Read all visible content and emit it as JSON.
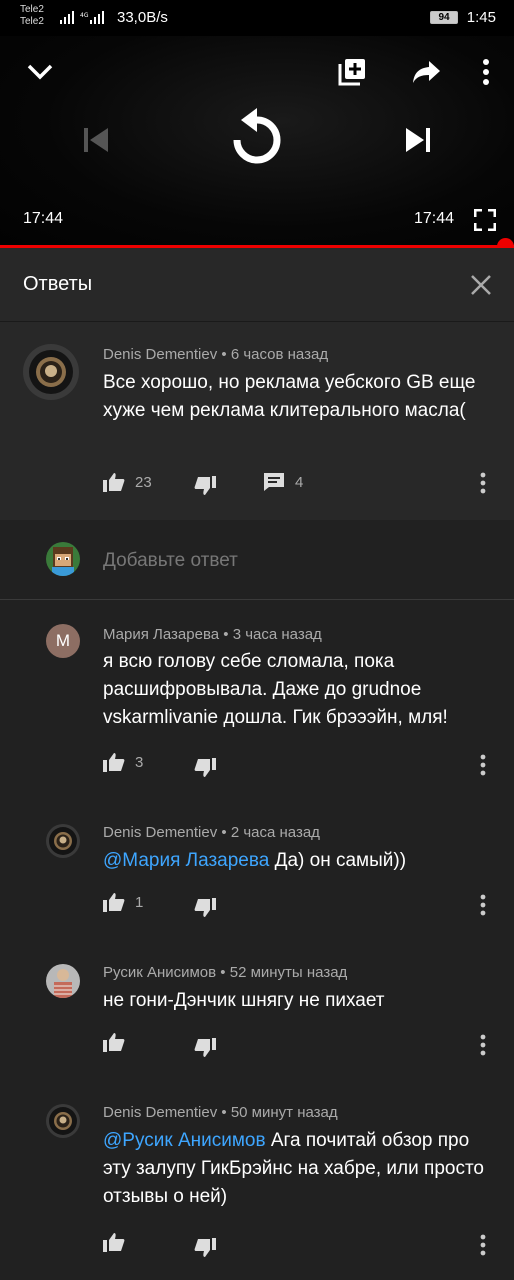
{
  "status_bar": {
    "carrier1": "Tele2",
    "carrier2": "Tele2",
    "network_speed": "33,0B/s",
    "battery": "94",
    "time": "1:45"
  },
  "player": {
    "current_time": "17:44",
    "duration": "17:44",
    "progress_fraction": 1.0,
    "icons": [
      "chevron-down-icon",
      "add-to-playlist-icon",
      "share-icon",
      "more-vert-icon",
      "skip-previous-icon",
      "replay-icon",
      "skip-next-icon",
      "fullscreen-icon"
    ]
  },
  "replies_panel": {
    "title": "Ответы"
  },
  "top_comment": {
    "author": "Denis Dementiev",
    "time": "6 часов назад",
    "text": "Все хорошо, но реклама уебского GB еще хуже чем реклама клитерального масла(",
    "likes": "23",
    "replies": "4"
  },
  "add_reply": {
    "placeholder": "Добавьте ответ"
  },
  "replies": [
    {
      "author": "Мария Лазарева",
      "time": "3 часа назад",
      "avatar_letter": "M",
      "mention": "",
      "text": "я всю голову себе сломала, пока расшифровывала. Даже до grudnoe vskarmlivanie дошла. Гик брэээйн, мля!",
      "likes": "3"
    },
    {
      "author": "Denis Dementiev",
      "time": "2 часа назад",
      "mention": "@Мария Лазарева",
      "text": " Да) он самый))",
      "likes": "1"
    },
    {
      "author": "Русик Анисимов",
      "time": "52 минуты назад",
      "mention": "",
      "text": "не гони-Дэнчик шнягу не пихает",
      "likes": ""
    },
    {
      "author": "Denis Dementiev",
      "time": "50 минут назад",
      "mention": "@Русик Анисимов",
      "text": " Ага почитай  обзор про эту залупу ГикБрэйнс на хабре, или просто отзывы о ней)",
      "likes": ""
    }
  ],
  "meta_separator": "•",
  "colors": {
    "background": "#212121",
    "header_bg": "#282828",
    "progress": "#ee0000",
    "mention": "#3ea6ff",
    "secondary_text": "#aaaaaa",
    "maria_avatar": "#8d6e63"
  }
}
